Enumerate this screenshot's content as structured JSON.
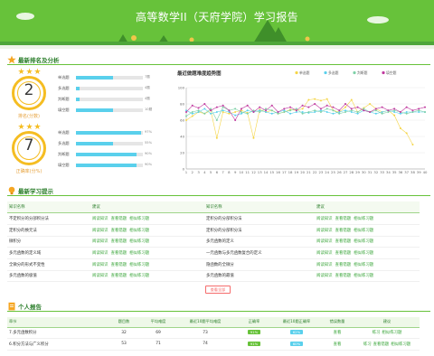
{
  "header": {
    "title": "高等数学II（天府学院）学习报告"
  },
  "colors": {
    "brand_green": "#67c23a",
    "medal_gold": "#f5bd22",
    "bar_blue": "#5ad0ec",
    "danger": "#f56c6c"
  },
  "sections": {
    "ranking": {
      "title": "最新排名及分析",
      "icon": "star-icon"
    },
    "tips": {
      "title": "最新学习提示",
      "icon": "bulb-icon"
    },
    "report": {
      "title": "个人报告",
      "icon": "document-icon"
    }
  },
  "medals": [
    {
      "value": "2",
      "caption": "排名(分数)"
    },
    {
      "value": "7",
      "caption": "正确率(分%)"
    }
  ],
  "bar_groups": [
    [
      {
        "label": "单选题",
        "value": 0.55,
        "text": "7题"
      },
      {
        "label": "多选题",
        "value": 0.05,
        "text": "4题"
      },
      {
        "label": "判断题",
        "value": 0.05,
        "text": "4题"
      },
      {
        "label": "填空题",
        "value": 0.55,
        "text": "10题"
      }
    ],
    [
      {
        "label": "单选题",
        "value": 0.97,
        "text": "97%"
      },
      {
        "label": "多选题",
        "value": 0.55,
        "text": "55%"
      },
      {
        "label": "判断题",
        "value": 0.9,
        "text": "90%"
      },
      {
        "label": "填空题",
        "value": 0.9,
        "text": "90%"
      }
    ]
  ],
  "chart_data": {
    "type": "line",
    "title": "最近做题难度趋势图",
    "x": [
      1,
      2,
      3,
      4,
      5,
      6,
      7,
      8,
      9,
      10,
      11,
      12,
      13,
      14,
      15,
      16,
      17,
      18,
      19,
      20,
      21,
      22,
      23,
      24,
      25,
      26,
      27,
      28,
      29,
      30,
      31,
      32,
      33,
      34,
      35,
      36,
      37,
      38,
      39,
      40
    ],
    "ylim": [
      0,
      100
    ],
    "yticks": [
      0,
      20,
      40,
      60,
      80,
      100
    ],
    "legend_position": "top-right",
    "grid": true,
    "series": [
      {
        "name": "单选题",
        "color": "#f5d547",
        "values": [
          60,
          65,
          70,
          68,
          72,
          38,
          70,
          68,
          70,
          72,
          69,
          38,
          73,
          70,
          72,
          68,
          70,
          73,
          72,
          74,
          85,
          86,
          84,
          86,
          72,
          70,
          76,
          85,
          70,
          75,
          80,
          74,
          70,
          72,
          66,
          50,
          44,
          30,
          null,
          null
        ]
      },
      {
        "name": "多选题",
        "color": "#5ad0ec",
        "values": [
          72,
          68,
          70,
          74,
          68,
          70,
          72,
          70,
          66,
          68,
          72,
          70,
          72,
          70,
          68,
          70,
          72,
          68,
          70,
          70,
          69,
          70,
          72,
          70,
          68,
          70,
          72,
          70,
          68,
          72,
          70,
          68,
          70,
          72,
          70,
          68,
          70,
          70,
          70,
          70
        ]
      },
      {
        "name": "判断题",
        "color": "#7fd1a8",
        "values": [
          65,
          70,
          72,
          68,
          74,
          60,
          76,
          72,
          74,
          70,
          68,
          72,
          70,
          74,
          72,
          68,
          70,
          72,
          74,
          68,
          70,
          72,
          70,
          74,
          72,
          68,
          70,
          72,
          70,
          74,
          70,
          72,
          68,
          70,
          72,
          70,
          68,
          70,
          72,
          70
        ]
      },
      {
        "name": "填空题",
        "color": "#c0399f",
        "values": [
          70,
          78,
          75,
          80,
          72,
          76,
          78,
          72,
          60,
          74,
          78,
          70,
          76,
          72,
          78,
          70,
          74,
          76,
          72,
          78,
          76,
          80,
          74,
          78,
          76,
          72,
          80,
          74,
          76,
          72,
          70,
          74,
          76,
          72,
          74,
          70,
          76,
          72,
          74,
          76
        ]
      }
    ]
  },
  "tips": {
    "headers": [
      "知识名称",
      "建议",
      "知识名称",
      "建议"
    ],
    "link_labels": [
      "阅读知识",
      "查看错题",
      "相似练习题"
    ],
    "rows": [
      [
        "不定积分的分部积分法",
        "定积分的分部积分法"
      ],
      [
        "定积分的换元法",
        "定积分的分部积分法"
      ],
      [
        "微积分",
        "多元函数的定义"
      ],
      [
        "多元函数的定义域",
        "一元函数与多元函数复合的定义"
      ],
      [
        "全微分的形式不变性",
        "隐函数的全微分"
      ],
      [
        "多元函数的极值",
        "多元函数的最值"
      ]
    ],
    "more_label": "查看全部"
  },
  "report": {
    "headers": [
      "章节",
      "题目数",
      "平均难度",
      "最近10题平均难度",
      "正确率",
      "最近10题正确率",
      "错误数量",
      "建议"
    ],
    "rows": [
      {
        "chapter": "7.多元函数积分",
        "count": "32",
        "avg": "69",
        "recent_avg": "73",
        "acc": "91%",
        "recent_acc": "62%",
        "wrong": "查看",
        "advice": [
          "练习",
          "相似练习题"
        ]
      },
      {
        "chapter": "6.积分方法与广义积分",
        "count": "53",
        "avg": "71",
        "recent_avg": "74",
        "acc": "91%",
        "recent_acc": "60%",
        "wrong": "查看",
        "advice": [
          "练习",
          "查看错题",
          "相似练习题"
        ]
      }
    ]
  }
}
